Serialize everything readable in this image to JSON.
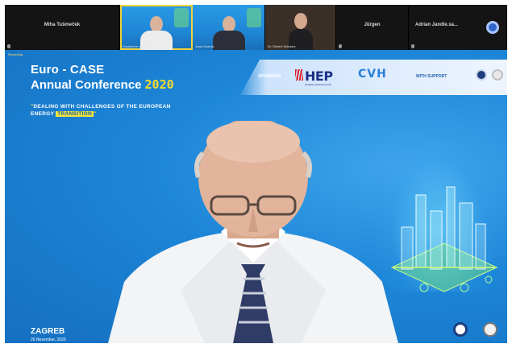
{
  "participants": [
    {
      "type": "name",
      "name": "Miha Tušmeček"
    },
    {
      "type": "video",
      "label": "Kroatische akademija",
      "active": true
    },
    {
      "type": "video",
      "label": "Josip Kuzmić"
    },
    {
      "type": "video",
      "label": "Dr. Robert Schwarz",
      "portrait": true
    },
    {
      "type": "name",
      "name": "Jürgen"
    },
    {
      "type": "name",
      "name": "Adrian Jandle.sa..."
    }
  ],
  "banner": {
    "corner_label": "Recording",
    "title_line1": "Euro - CASE",
    "title_line2": "Annual Conference",
    "year": "2020",
    "subtitle_open_quote": "\"",
    "subtitle_part1": "DEALING WITH CHALLENGES OF THE EUROPEAN ENERGY ",
    "subtitle_highlight": "TRANSITION",
    "subtitle_close_quote": "\"",
    "sponsored_by": "SPONSORS",
    "hep_word": "HEP",
    "hep_tagline": "Hrvatska elektroprivreda",
    "cvh_word": "CVH",
    "with_support": "WITH SUPPORT",
    "city": "ZAGREB",
    "date": "26 November, 2020"
  },
  "colors": {
    "banner_blue": "#1d86d8",
    "year_yellow": "#f5dc2a",
    "highlight_yellow": "#f2e63a",
    "hep_red": "#d91f26",
    "hep_navy": "#1b2f86",
    "cvh_blue": "#2a7fd6"
  }
}
